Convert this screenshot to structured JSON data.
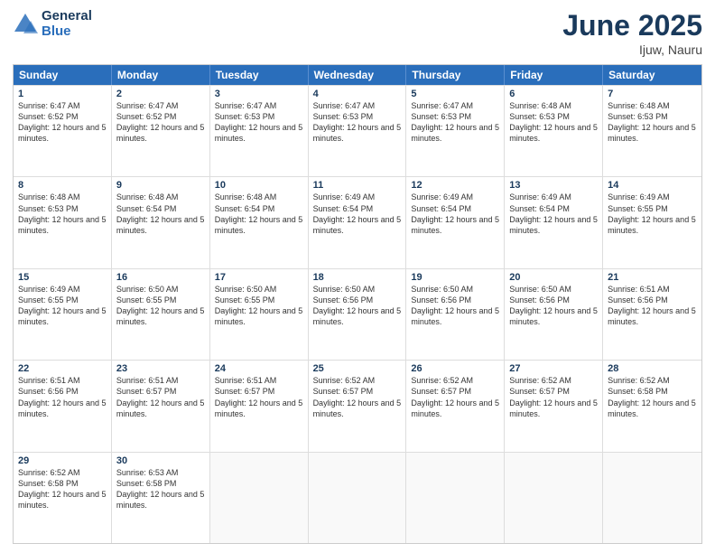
{
  "header": {
    "logo_line1": "General",
    "logo_line2": "Blue",
    "month": "June 2025",
    "location": "Ijuw, Nauru"
  },
  "weekdays": [
    "Sunday",
    "Monday",
    "Tuesday",
    "Wednesday",
    "Thursday",
    "Friday",
    "Saturday"
  ],
  "weeks": [
    [
      {
        "day": "1",
        "rise": "6:47 AM",
        "set": "6:52 PM",
        "daylight": "12 hours and 5 minutes."
      },
      {
        "day": "2",
        "rise": "6:47 AM",
        "set": "6:52 PM",
        "daylight": "12 hours and 5 minutes."
      },
      {
        "day": "3",
        "rise": "6:47 AM",
        "set": "6:53 PM",
        "daylight": "12 hours and 5 minutes."
      },
      {
        "day": "4",
        "rise": "6:47 AM",
        "set": "6:53 PM",
        "daylight": "12 hours and 5 minutes."
      },
      {
        "day": "5",
        "rise": "6:47 AM",
        "set": "6:53 PM",
        "daylight": "12 hours and 5 minutes."
      },
      {
        "day": "6",
        "rise": "6:48 AM",
        "set": "6:53 PM",
        "daylight": "12 hours and 5 minutes."
      },
      {
        "day": "7",
        "rise": "6:48 AM",
        "set": "6:53 PM",
        "daylight": "12 hours and 5 minutes."
      }
    ],
    [
      {
        "day": "8",
        "rise": "6:48 AM",
        "set": "6:53 PM",
        "daylight": "12 hours and 5 minutes."
      },
      {
        "day": "9",
        "rise": "6:48 AM",
        "set": "6:54 PM",
        "daylight": "12 hours and 5 minutes."
      },
      {
        "day": "10",
        "rise": "6:48 AM",
        "set": "6:54 PM",
        "daylight": "12 hours and 5 minutes."
      },
      {
        "day": "11",
        "rise": "6:49 AM",
        "set": "6:54 PM",
        "daylight": "12 hours and 5 minutes."
      },
      {
        "day": "12",
        "rise": "6:49 AM",
        "set": "6:54 PM",
        "daylight": "12 hours and 5 minutes."
      },
      {
        "day": "13",
        "rise": "6:49 AM",
        "set": "6:54 PM",
        "daylight": "12 hours and 5 minutes."
      },
      {
        "day": "14",
        "rise": "6:49 AM",
        "set": "6:55 PM",
        "daylight": "12 hours and 5 minutes."
      }
    ],
    [
      {
        "day": "15",
        "rise": "6:49 AM",
        "set": "6:55 PM",
        "daylight": "12 hours and 5 minutes."
      },
      {
        "day": "16",
        "rise": "6:50 AM",
        "set": "6:55 PM",
        "daylight": "12 hours and 5 minutes."
      },
      {
        "day": "17",
        "rise": "6:50 AM",
        "set": "6:55 PM",
        "daylight": "12 hours and 5 minutes."
      },
      {
        "day": "18",
        "rise": "6:50 AM",
        "set": "6:56 PM",
        "daylight": "12 hours and 5 minutes."
      },
      {
        "day": "19",
        "rise": "6:50 AM",
        "set": "6:56 PM",
        "daylight": "12 hours and 5 minutes."
      },
      {
        "day": "20",
        "rise": "6:50 AM",
        "set": "6:56 PM",
        "daylight": "12 hours and 5 minutes."
      },
      {
        "day": "21",
        "rise": "6:51 AM",
        "set": "6:56 PM",
        "daylight": "12 hours and 5 minutes."
      }
    ],
    [
      {
        "day": "22",
        "rise": "6:51 AM",
        "set": "6:56 PM",
        "daylight": "12 hours and 5 minutes."
      },
      {
        "day": "23",
        "rise": "6:51 AM",
        "set": "6:57 PM",
        "daylight": "12 hours and 5 minutes."
      },
      {
        "day": "24",
        "rise": "6:51 AM",
        "set": "6:57 PM",
        "daylight": "12 hours and 5 minutes."
      },
      {
        "day": "25",
        "rise": "6:52 AM",
        "set": "6:57 PM",
        "daylight": "12 hours and 5 minutes."
      },
      {
        "day": "26",
        "rise": "6:52 AM",
        "set": "6:57 PM",
        "daylight": "12 hours and 5 minutes."
      },
      {
        "day": "27",
        "rise": "6:52 AM",
        "set": "6:57 PM",
        "daylight": "12 hours and 5 minutes."
      },
      {
        "day": "28",
        "rise": "6:52 AM",
        "set": "6:58 PM",
        "daylight": "12 hours and 5 minutes."
      }
    ],
    [
      {
        "day": "29",
        "rise": "6:52 AM",
        "set": "6:58 PM",
        "daylight": "12 hours and 5 minutes."
      },
      {
        "day": "30",
        "rise": "6:53 AM",
        "set": "6:58 PM",
        "daylight": "12 hours and 5 minutes."
      },
      null,
      null,
      null,
      null,
      null
    ]
  ]
}
